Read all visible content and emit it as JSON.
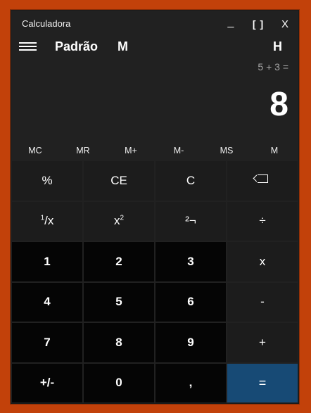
{
  "window": {
    "title": "Calculadora",
    "minimize_label": "_",
    "maximize_label": "[ ]",
    "close_label": "X"
  },
  "header": {
    "mode": "Padrão",
    "memory_indicator": "M",
    "history_label": "H"
  },
  "display": {
    "expression": "5 + 3 =",
    "value": "8"
  },
  "memory": [
    "MC",
    "MR",
    "M+",
    "M-",
    "MS",
    "M"
  ],
  "keys": {
    "percent": "%",
    "ce": "CE",
    "clear": "C",
    "reciprocal_sup": "1",
    "reciprocal_rest": "/x",
    "square_base": "x",
    "square_sup": "2",
    "sqrt": "²¬",
    "divide": "÷",
    "multiply": "x",
    "minus": "-",
    "plus": "+",
    "equals": "=",
    "negate": "+/-",
    "decimal": ",",
    "digits": [
      "0",
      "1",
      "2",
      "3",
      "4",
      "5",
      "6",
      "7",
      "8",
      "9"
    ]
  }
}
